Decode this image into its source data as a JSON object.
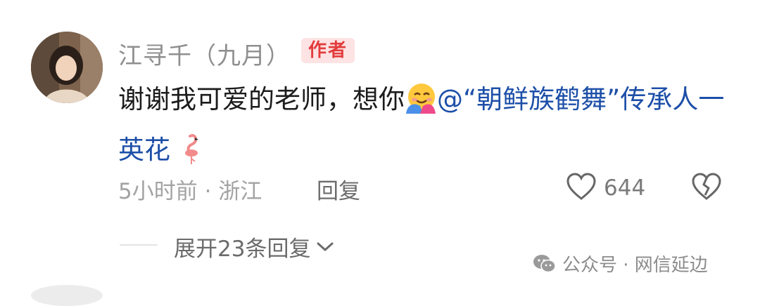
{
  "comment": {
    "username": "江寻千（九月）",
    "badge": "作者",
    "text_before": "谢谢我可爱的老师，想你",
    "emoji_hug": "hugging-face-emoji",
    "mention": "@“朝鲜族鹤舞”传承人一 英花",
    "emoji_flamingo": "flamingo-emoji",
    "time_location": "5小时前 · 浙江",
    "reply_label": "回复",
    "like_count": "644",
    "expand_label": "展开23条回复"
  },
  "watermark": {
    "icon": "wechat-icon",
    "text": "公众号 · 网信延边"
  },
  "colors": {
    "badge_bg": "#fde3e3",
    "badge_text": "#e33c3c",
    "mention": "#1d4fa8"
  }
}
